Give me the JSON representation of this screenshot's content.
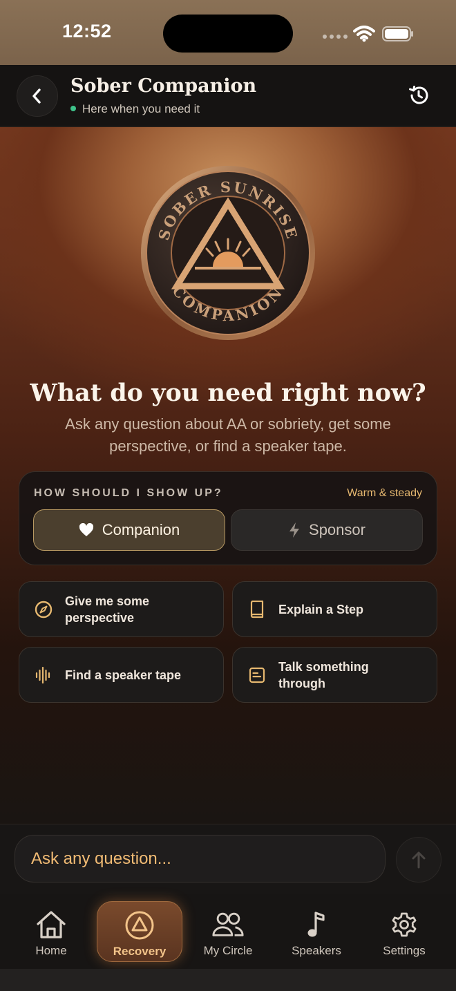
{
  "status_bar": {
    "time": "12:52"
  },
  "header": {
    "title": "Sober Companion",
    "status": "Here when you need it",
    "status_color": "#3ec28a"
  },
  "medallion": {
    "top_text": "SOBER SUNRISE",
    "bottom_text": "COMPANION"
  },
  "hero": {
    "headline": "What do you need right now?",
    "subtext": "Ask any question about AA or sobriety, get some perspective, or find a speaker tape."
  },
  "mode": {
    "label": "HOW SHOULD I SHOW UP?",
    "hint": "Warm & steady",
    "options": [
      {
        "label": "Companion",
        "icon": "heart-icon",
        "selected": true
      },
      {
        "label": "Sponsor",
        "icon": "bolt-icon",
        "selected": false
      }
    ]
  },
  "actions": [
    {
      "label": "Give me some perspective",
      "icon": "compass-icon"
    },
    {
      "label": "Explain a Step",
      "icon": "book-icon"
    },
    {
      "label": "Find a speaker tape",
      "icon": "waveform-icon"
    },
    {
      "label": "Talk something through",
      "icon": "note-icon"
    }
  ],
  "input": {
    "placeholder": "Ask any question..."
  },
  "tabs": [
    {
      "label": "Home",
      "icon": "home-icon"
    },
    {
      "label": "Recovery",
      "icon": "recovery-triangle-icon",
      "active": true
    },
    {
      "label": "My Circle",
      "icon": "people-icon"
    },
    {
      "label": "Speakers",
      "icon": "music-note-icon"
    },
    {
      "label": "Settings",
      "icon": "gear-icon"
    }
  ],
  "colors": {
    "accent": "#e6b870",
    "input_text": "#f1bb74",
    "active_tab_text": "#f3c48a"
  }
}
